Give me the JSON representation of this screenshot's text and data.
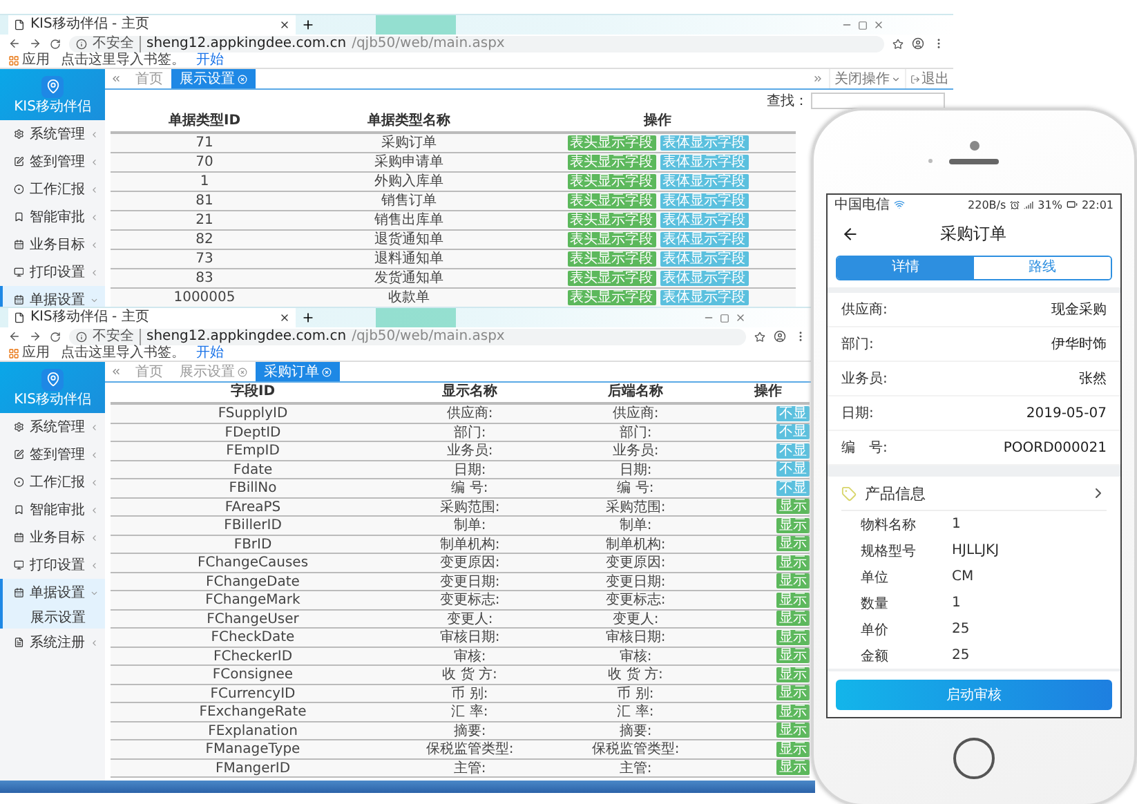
{
  "browsers": [
    {
      "tab_title": "KIS移动伴侣 - 主页",
      "security": "不安全",
      "url_host": "sheng12.appkingdee.com.cn",
      "url_path": "/qjb50/web/main.aspx",
      "bookmarks": [
        {
          "label": "应用",
          "kind": "apps"
        },
        {
          "label": "点击这里导入书签。",
          "kind": "text"
        },
        {
          "label": "开始",
          "kind": "link"
        }
      ],
      "logo": "KIS移动伴侣",
      "sidebar": [
        {
          "label": "系统管理",
          "selected": false,
          "expanded": false
        },
        {
          "label": "签到管理",
          "selected": false,
          "expanded": false
        },
        {
          "label": "工作汇报",
          "selected": false,
          "expanded": false
        },
        {
          "label": "智能审批",
          "selected": false,
          "expanded": false
        },
        {
          "label": "业务目标",
          "selected": false,
          "expanded": false
        },
        {
          "label": "打印设置",
          "selected": false,
          "expanded": false
        },
        {
          "label": "单据设置",
          "selected": true,
          "expanded": true
        }
      ],
      "page_tabs": [
        {
          "label": "首页",
          "selected": false,
          "closable": false
        },
        {
          "label": "展示设置",
          "selected": true,
          "closable": true
        }
      ],
      "tab_actions": [
        {
          "label": "关闭操作",
          "kind": "menu"
        },
        {
          "label": "退出",
          "kind": "exit"
        }
      ],
      "search_label": "查找：",
      "table": {
        "columns": [
          "单据类型ID",
          "单据类型名称",
          "操作"
        ],
        "rows": [
          {
            "cells": [
              "71",
              "采购订单"
            ],
            "actions": [
              {
                "label": "表头显示字段",
                "color": "#5cb85c"
              },
              {
                "label": "表体显示字段",
                "color": "#5bc0de"
              }
            ]
          },
          {
            "cells": [
              "70",
              "采购申请单"
            ],
            "actions": [
              {
                "label": "表头显示字段",
                "color": "#5cb85c"
              },
              {
                "label": "表体显示字段",
                "color": "#5bc0de"
              }
            ]
          },
          {
            "cells": [
              "1",
              "外购入库单"
            ],
            "actions": [
              {
                "label": "表头显示字段",
                "color": "#5cb85c"
              },
              {
                "label": "表体显示字段",
                "color": "#5bc0de"
              }
            ]
          },
          {
            "cells": [
              "81",
              "销售订单"
            ],
            "actions": [
              {
                "label": "表头显示字段",
                "color": "#5cb85c"
              },
              {
                "label": "表体显示字段",
                "color": "#5bc0de"
              }
            ]
          },
          {
            "cells": [
              "21",
              "销售出库单"
            ],
            "actions": [
              {
                "label": "表头显示字段",
                "color": "#5cb85c"
              },
              {
                "label": "表体显示字段",
                "color": "#5bc0de"
              }
            ]
          },
          {
            "cells": [
              "82",
              "退货通知单"
            ],
            "actions": [
              {
                "label": "表头显示字段",
                "color": "#5cb85c"
              },
              {
                "label": "表体显示字段",
                "color": "#5bc0de"
              }
            ]
          },
          {
            "cells": [
              "73",
              "退料通知单"
            ],
            "actions": [
              {
                "label": "表头显示字段",
                "color": "#5cb85c"
              },
              {
                "label": "表体显示字段",
                "color": "#5bc0de"
              }
            ]
          },
          {
            "cells": [
              "83",
              "发货通知单"
            ],
            "actions": [
              {
                "label": "表头显示字段",
                "color": "#5cb85c"
              },
              {
                "label": "表体显示字段",
                "color": "#5bc0de"
              }
            ]
          },
          {
            "cells": [
              "1000005",
              "收款单"
            ],
            "actions": [
              {
                "label": "表头显示字段",
                "color": "#5cb85c"
              },
              {
                "label": "表体显示字段",
                "color": "#5bc0de"
              }
            ]
          }
        ]
      }
    },
    {
      "tab_title": "KIS移动伴侣 - 主页",
      "security": "不安全",
      "url_host": "sheng12.appkingdee.com.cn",
      "url_path": "/qjb50/web/main.aspx",
      "bookmarks": [
        {
          "label": "应用",
          "kind": "apps"
        },
        {
          "label": "点击这里导入书签。",
          "kind": "text"
        },
        {
          "label": "开始",
          "kind": "link"
        }
      ],
      "logo": "KIS移动伴侣",
      "sidebar": [
        {
          "label": "系统管理",
          "selected": false,
          "expanded": false
        },
        {
          "label": "签到管理",
          "selected": false,
          "expanded": false
        },
        {
          "label": "工作汇报",
          "selected": false,
          "expanded": false
        },
        {
          "label": "智能审批",
          "selected": false,
          "expanded": false
        },
        {
          "label": "业务目标",
          "selected": false,
          "expanded": false
        },
        {
          "label": "打印设置",
          "selected": false,
          "expanded": false
        },
        {
          "label": "单据设置",
          "selected": true,
          "expanded": true,
          "children": [
            {
              "label": "展示设置"
            }
          ]
        },
        {
          "label": "系统注册",
          "selected": false,
          "expanded": false
        }
      ],
      "page_tabs": [
        {
          "label": "首页",
          "selected": false,
          "closable": false
        },
        {
          "label": "展示设置",
          "selected": false,
          "closable": true
        },
        {
          "label": "采购订单",
          "selected": true,
          "closable": true
        }
      ],
      "table": {
        "columns": [
          "字段ID",
          "显示名称",
          "后端名称",
          "操作"
        ],
        "rows": [
          {
            "cells": [
              "FSupplyID",
              "供应商:",
              "供应商:"
            ],
            "actions": [
              {
                "label": "不显",
                "color": "#5bc0de"
              }
            ]
          },
          {
            "cells": [
              "FDeptID",
              "部门:",
              "部门:"
            ],
            "actions": [
              {
                "label": "不显",
                "color": "#5bc0de"
              }
            ]
          },
          {
            "cells": [
              "FEmpID",
              "业务员:",
              "业务员:"
            ],
            "actions": [
              {
                "label": "不显",
                "color": "#5bc0de"
              }
            ]
          },
          {
            "cells": [
              "Fdate",
              "日期:",
              "日期:"
            ],
            "actions": [
              {
                "label": "不显",
                "color": "#5bc0de"
              }
            ]
          },
          {
            "cells": [
              "FBillNo",
              "编 号:",
              "编 号:"
            ],
            "actions": [
              {
                "label": "不显",
                "color": "#5bc0de"
              }
            ]
          },
          {
            "cells": [
              "FAreaPS",
              "采购范围:",
              "采购范围:"
            ],
            "actions": [
              {
                "label": "显示",
                "color": "#5cb85c"
              }
            ]
          },
          {
            "cells": [
              "FBillerID",
              "制单:",
              "制单:"
            ],
            "actions": [
              {
                "label": "显示",
                "color": "#5cb85c"
              }
            ]
          },
          {
            "cells": [
              "FBrID",
              "制单机构:",
              "制单机构:"
            ],
            "actions": [
              {
                "label": "显示",
                "color": "#5cb85c"
              }
            ]
          },
          {
            "cells": [
              "FChangeCauses",
              "变更原因:",
              "变更原因:"
            ],
            "actions": [
              {
                "label": "显示",
                "color": "#5cb85c"
              }
            ]
          },
          {
            "cells": [
              "FChangeDate",
              "变更日期:",
              "变更日期:"
            ],
            "actions": [
              {
                "label": "显示",
                "color": "#5cb85c"
              }
            ]
          },
          {
            "cells": [
              "FChangeMark",
              "变更标志:",
              "变更标志:"
            ],
            "actions": [
              {
                "label": "显示",
                "color": "#5cb85c"
              }
            ]
          },
          {
            "cells": [
              "FChangeUser",
              "变更人:",
              "变更人:"
            ],
            "actions": [
              {
                "label": "显示",
                "color": "#5cb85c"
              }
            ]
          },
          {
            "cells": [
              "FCheckDate",
              "审核日期:",
              "审核日期:"
            ],
            "actions": [
              {
                "label": "显示",
                "color": "#5cb85c"
              }
            ]
          },
          {
            "cells": [
              "FCheckerID",
              "审核:",
              "审核:"
            ],
            "actions": [
              {
                "label": "显示",
                "color": "#5cb85c"
              }
            ]
          },
          {
            "cells": [
              "FConsignee",
              "收 货 方:",
              "收 货 方:"
            ],
            "actions": [
              {
                "label": "显示",
                "color": "#5cb85c"
              }
            ]
          },
          {
            "cells": [
              "FCurrencyID",
              "币 别:",
              "币 别:"
            ],
            "actions": [
              {
                "label": "显示",
                "color": "#5cb85c"
              }
            ]
          },
          {
            "cells": [
              "FExchangeRate",
              "汇 率:",
              "汇 率:"
            ],
            "actions": [
              {
                "label": "显示",
                "color": "#5cb85c"
              }
            ]
          },
          {
            "cells": [
              "FExplanation",
              "摘要:",
              "摘要:"
            ],
            "actions": [
              {
                "label": "显示",
                "color": "#5cb85c"
              }
            ]
          },
          {
            "cells": [
              "FManageType",
              "保税监管类型:",
              "保税监管类型:"
            ],
            "actions": [
              {
                "label": "显示",
                "color": "#5cb85c"
              }
            ]
          },
          {
            "cells": [
              "FMangerID",
              "主管:",
              "主管:"
            ],
            "actions": [
              {
                "label": "显示",
                "color": "#5cb85c"
              }
            ]
          }
        ]
      }
    }
  ],
  "phone": {
    "status": {
      "carrier": "中国电信",
      "speed": "220B/s",
      "battery": "31%",
      "time": "22:01"
    },
    "title": "采购订单",
    "tabs": [
      {
        "label": "详情",
        "selected": true
      },
      {
        "label": "路线",
        "selected": false
      }
    ],
    "fields": [
      {
        "label": "供应商:",
        "value": "现金采购"
      },
      {
        "label": "部门:",
        "value": "伊华时饰"
      },
      {
        "label": "业务员:",
        "value": "张然"
      },
      {
        "label": "日期:",
        "value": "2019-05-07"
      },
      {
        "label": "编　号:",
        "value": "POORD000021"
      }
    ],
    "section": {
      "title": "产品信息",
      "items": [
        {
          "label": "物料名称",
          "value": "1"
        },
        {
          "label": "规格型号",
          "value": "HJLLJKJ"
        },
        {
          "label": "单位",
          "value": "CM"
        },
        {
          "label": "数量",
          "value": "1"
        },
        {
          "label": "单价",
          "value": "25"
        },
        {
          "label": "金额",
          "value": "25"
        }
      ]
    },
    "action": "启动审核"
  }
}
